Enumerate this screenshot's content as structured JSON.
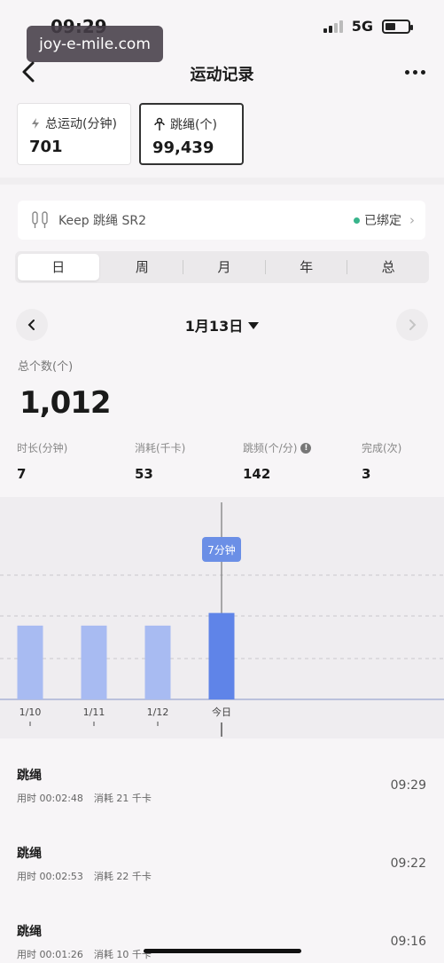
{
  "status": {
    "time": "09:29",
    "network": "5G",
    "battery_level": 0.45
  },
  "watermark": "joy-e-mile.com",
  "nav": {
    "title": "运动记录",
    "back_icon": "chevron-left-icon",
    "more_icon": "more-icon"
  },
  "summary": [
    {
      "label": "总运动(分钟)",
      "value": "701",
      "icon": "bolt-icon"
    },
    {
      "label": "跳绳(个)",
      "value": "99,439",
      "icon": "jump-rope-icon"
    }
  ],
  "device": {
    "name": "Keep 跳绳 SR2",
    "status": "已绑定"
  },
  "tabs": [
    "日",
    "周",
    "月",
    "年",
    "总"
  ],
  "date": {
    "label": "1月13日"
  },
  "total": {
    "label": "总个数(个)",
    "value": "1,012"
  },
  "stats": [
    {
      "label": "时长(分钟)",
      "value": "7"
    },
    {
      "label": "消耗(千卡)",
      "value": "53"
    },
    {
      "label": "跳频(个/分)",
      "value": "142"
    },
    {
      "label": "完成(次)",
      "value": "3"
    }
  ],
  "chart_data": {
    "type": "bar",
    "categories": [
      "1/10",
      "1/11",
      "1/12",
      "今日"
    ],
    "values": [
      7,
      7,
      7,
      8.2
    ],
    "highlight_index": 3,
    "tooltip": "7分钟",
    "ylim": [
      0,
      16
    ],
    "colors": {
      "bar": "#a8bbf2",
      "highlight": "#5f84e8",
      "tooltip": "#6b8fe6"
    }
  },
  "records": [
    {
      "title": "跳绳",
      "duration": "用时 00:02:48",
      "calories": "消耗 21 千卡",
      "time": "09:29"
    },
    {
      "title": "跳绳",
      "duration": "用时 00:02:53",
      "calories": "消耗 22 千卡",
      "time": "09:22"
    },
    {
      "title": "跳绳",
      "duration": "用时 00:01:26",
      "calories": "消耗 10 千卡",
      "time": "09:16"
    }
  ]
}
